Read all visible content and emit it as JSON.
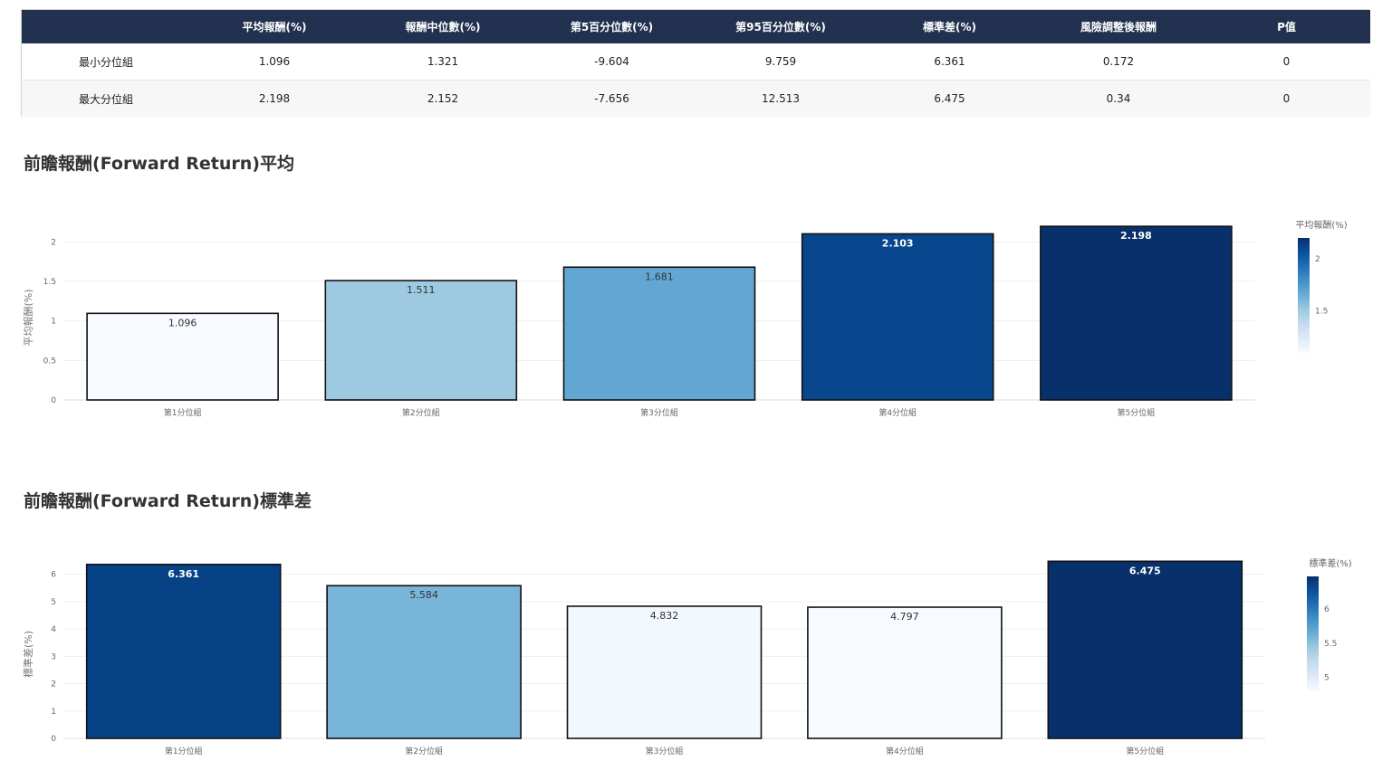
{
  "table": {
    "headers": [
      "",
      "平均報酬(%)",
      "報酬中位數(%)",
      "第5百分位數(%)",
      "第95百分位數(%)",
      "標準差(%)",
      "風險調整後報酬",
      "P值"
    ],
    "rows": [
      [
        "最小分位組",
        "1.096",
        "1.321",
        "-9.604",
        "9.759",
        "6.361",
        "0.172",
        "0"
      ],
      [
        "最大分位組",
        "2.198",
        "2.152",
        "-7.656",
        "12.513",
        "6.475",
        "0.34",
        "0"
      ]
    ]
  },
  "chart_data": [
    {
      "type": "bar",
      "title": "前瞻報酬(Forward Return)平均",
      "ylabel": "平均報酬(%)",
      "categories": [
        "第1分位組",
        "第2分位組",
        "第3分位組",
        "第4分位組",
        "第5分位組"
      ],
      "values": [
        1.096,
        1.511,
        1.681,
        2.103,
        2.198
      ],
      "data_labels": [
        "1.096",
        "1.511",
        "1.681",
        "2.103",
        "2.198"
      ],
      "ylim": [
        0,
        2.314
      ],
      "yticks": [
        0,
        0.5,
        1,
        1.5,
        2
      ],
      "ytick_labels": [
        "0",
        "0.5",
        "1",
        "1.5",
        "2"
      ],
      "colorbar": {
        "title": "平均報酬(%)",
        "range": [
          1.096,
          2.198
        ],
        "ticks": [
          1.5,
          2
        ],
        "tick_labels": [
          "1.5",
          "2"
        ]
      },
      "colorscale": "Blues",
      "grid": true,
      "legend": "colorbar-right"
    },
    {
      "type": "bar",
      "title": "前瞻報酬(Forward Return)標準差",
      "ylabel": "標準差(%)",
      "categories": [
        "第1分位組",
        "第2分位組",
        "第3分位組",
        "第4分位組",
        "第5分位組"
      ],
      "values": [
        6.361,
        5.584,
        4.832,
        4.797,
        6.475
      ],
      "data_labels": [
        "6.361",
        "5.584",
        "4.832",
        "4.797",
        "6.475"
      ],
      "ylim": [
        0,
        6.816
      ],
      "yticks": [
        0,
        1,
        2,
        3,
        4,
        5,
        6
      ],
      "ytick_labels": [
        "0",
        "1",
        "2",
        "3",
        "4",
        "5",
        "6"
      ],
      "colorbar": {
        "title": "標準差(%)",
        "range": [
          4.797,
          6.475
        ],
        "ticks": [
          5,
          5.5,
          6
        ],
        "tick_labels": [
          "5",
          "5.5",
          "6"
        ]
      },
      "colorscale": "Blues",
      "grid": true,
      "legend": "colorbar-right"
    }
  ]
}
